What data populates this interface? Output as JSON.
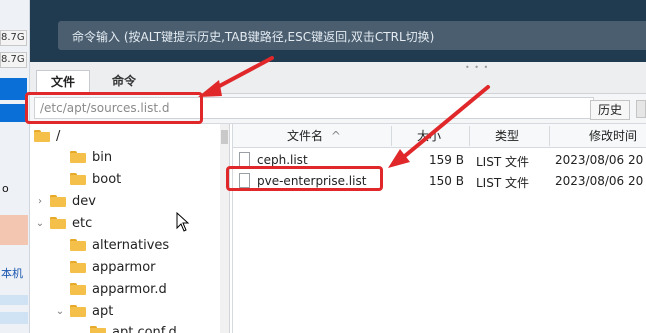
{
  "left_strip": {
    "cell1": "8.7G",
    "cell2": "8.7G",
    "label_o": "o",
    "label_bottom": "本机"
  },
  "terminal": {
    "command_placeholder": "命令输入 (按ALT键提示历史,TAB键路径,ESC键返回,双击CTRL切换)",
    "right_button": "历"
  },
  "tabs": [
    {
      "label": "文件"
    },
    {
      "label": "命令"
    }
  ],
  "path_bar": {
    "path": "/etc/apt/sources.list.d",
    "history_button": "历史"
  },
  "tree": {
    "items": [
      {
        "label": "/"
      },
      {
        "label": "bin"
      },
      {
        "label": "boot"
      },
      {
        "label": "dev"
      },
      {
        "label": "etc"
      },
      {
        "label": "alternatives"
      },
      {
        "label": "apparmor"
      },
      {
        "label": "apparmor.d"
      },
      {
        "label": "apt"
      },
      {
        "label": "apt.conf.d"
      }
    ]
  },
  "file_list": {
    "columns": {
      "name": "文件名",
      "size": "大小",
      "type": "类型",
      "modified": "修改时间"
    },
    "rows": [
      {
        "name": "ceph.list",
        "size": "159 B",
        "type": "LIST 文件",
        "modified": "2023/08/06 20"
      },
      {
        "name": "pve-enterprise.list",
        "size": "150 B",
        "type": "LIST 文件",
        "modified": "2023/08/06 20"
      }
    ]
  },
  "colors": {
    "terminal_bg": "#203a4f",
    "annotation_red": "#e0282b",
    "folder_yellow": "#f4c04a"
  }
}
